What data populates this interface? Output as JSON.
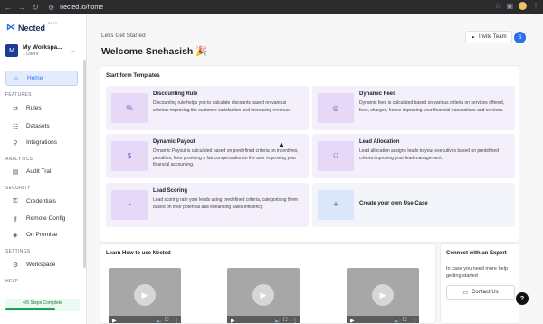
{
  "browser": {
    "url": "nected.io/home"
  },
  "app": {
    "name": "Nected",
    "beta": "BETA"
  },
  "workspace": {
    "initial": "M",
    "name": "My Workspa...",
    "users": "1 Users"
  },
  "sidebar": {
    "home": "Home",
    "sections": {
      "features": "FEATURES",
      "analytics": "ANALYTICS",
      "security": "SECURITY",
      "settings": "SETTINGS",
      "help": "HELP"
    },
    "items": {
      "rules": "Rules",
      "datasets": "Datasets",
      "integrations": "Integrations",
      "audit_trail": "Audit Trail",
      "credentials": "Credentials",
      "remote_config": "Remote Config",
      "on_premise": "On Premise",
      "workspace": "Workspace"
    },
    "steps": {
      "label": "4/6 Steps Complete",
      "progress": 0.67
    }
  },
  "header": {
    "pre_title": "Let's Get Started",
    "welcome": "Welcome Snehasish 🎉",
    "invite": "Invite Team",
    "user_initial": "S"
  },
  "templates": {
    "title": "Start form Templates",
    "cards": [
      {
        "title": "Discounting Rule",
        "desc": "Discounting rule helps you to calculate discounts based on various criterias improving the customer satisfaction and increasing revenue.",
        "icon": "percent-icon"
      },
      {
        "title": "Dynamic Fees",
        "desc": "Dynamic fees is calculated based on various criteria on services offered, fees, charges, hence improving your financial transactions and services.",
        "icon": "coin-icon"
      },
      {
        "title": "Dynamic Payout",
        "desc": "Dynamic Payout is calculated based on predefined criteria on incentives, penalties, fees providing a fair compensation to the user improving your financial accounting.",
        "icon": "document-dollar-icon"
      },
      {
        "title": "Lead Allocation",
        "desc": "Lead allocation assigns leads to your executives based on predefined criteria improving your lead management.",
        "icon": "people-icon"
      },
      {
        "title": "Lead Scoring",
        "desc": "Lead scoring rate your leads using predefined criteria, categorising them based on their potential and enhancing sales efficiency.",
        "icon": "gauge-icon"
      }
    ],
    "create": {
      "title": "Create your own Use Case",
      "icon": "plus-icon"
    }
  },
  "learn": {
    "title": "Learn How to use Nected"
  },
  "expert": {
    "title": "Connect with an Expert",
    "desc": "In case you need more help getting started",
    "button": "Contact Us"
  },
  "help_button": "?"
}
